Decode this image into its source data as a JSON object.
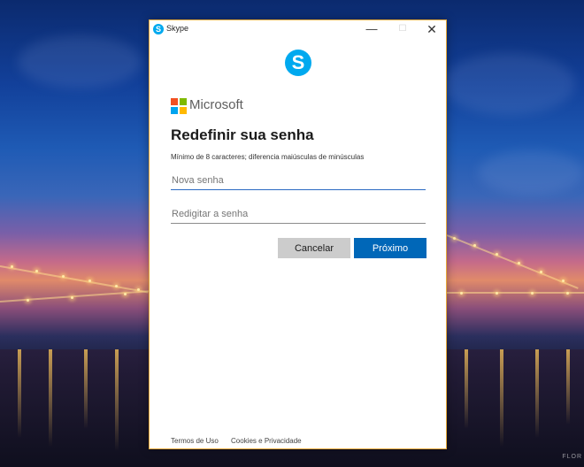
{
  "window": {
    "title": "Skype",
    "close_glyph": "✕",
    "minimize_glyph": "—",
    "maximize_glyph": "☐"
  },
  "brand": {
    "skype_icon": "skype-icon",
    "skype_letter": "S",
    "microsoft_text": "Microsoft"
  },
  "form": {
    "heading": "Redefinir sua senha",
    "hint": "Mínimo de 8 caracteres; diferencia maiúsculas de minúsculas",
    "new_password_placeholder": "Nova senha",
    "confirm_password_placeholder": "Redigitar a senha",
    "cancel_label": "Cancelar",
    "next_label": "Próximo"
  },
  "footer": {
    "terms": "Termos de Uso",
    "privacy": "Cookies e Privacidade"
  },
  "desktop": {
    "watermark": "FLOR"
  },
  "colors": {
    "accent": "#0067b8",
    "skype": "#00a9ef",
    "window_border": "#e6a93a"
  }
}
